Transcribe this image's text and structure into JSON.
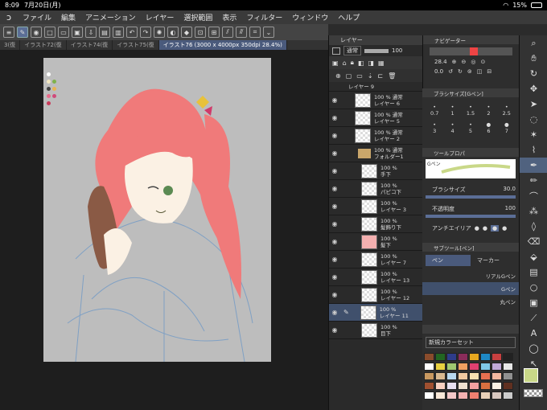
{
  "status": {
    "time": "8:09",
    "date": "7月20日(月)",
    "battery": "15%"
  },
  "menu": [
    "ファイル",
    "編集",
    "アニメーション",
    "レイヤー",
    "選択範囲",
    "表示",
    "フィルター",
    "ウィンドウ",
    "ヘルプ"
  ],
  "tabs": [
    "3(復",
    "イラスト72(復",
    "イラスト74(復",
    "イラスト75(復",
    "イラスト76 (3000 x 4000px 350dpi 28.4%)"
  ],
  "layers": {
    "title": "レイヤー",
    "blend": "通常",
    "opacity": "100",
    "items": [
      {
        "percent": "",
        "name": "レイヤー 9"
      },
      {
        "percent": "100 % 通常",
        "name": "レイヤー 6"
      },
      {
        "percent": "100 % 通常",
        "name": "レイヤー 5"
      },
      {
        "percent": "100 % 通常",
        "name": "レイヤー 2"
      },
      {
        "percent": "100 % 通常",
        "name": "フォルダー1"
      },
      {
        "percent": "100 %",
        "name": "手下"
      },
      {
        "percent": "100 %",
        "name": "パピコ下"
      },
      {
        "percent": "100 %",
        "name": "レイヤー 3"
      },
      {
        "percent": "100 %",
        "name": "髪飾り下"
      },
      {
        "percent": "100 %",
        "name": "髪下"
      },
      {
        "percent": "100 %",
        "name": "レイヤー 7"
      },
      {
        "percent": "100 %",
        "name": "レイヤー 13"
      },
      {
        "percent": "100 %",
        "name": "レイヤー 12"
      },
      {
        "percent": "100 %",
        "name": "レイヤー 11"
      },
      {
        "percent": "100 %",
        "name": "目下"
      }
    ]
  },
  "navigator": {
    "title": "ナビゲーター",
    "zoom": "28.4",
    "angle": "0.0"
  },
  "brush_size": {
    "title": "ブラシサイズ[Gペン]",
    "values": [
      "0.7",
      "1",
      "1.5",
      "2",
      "2.5",
      "3",
      "4",
      "5",
      "6",
      "7"
    ]
  },
  "tool_property": {
    "title": "ツールプロパ",
    "size_label": "ブラシサイズ",
    "size_value": "30.0",
    "opacity_label": "不透明度",
    "opacity_value": "100",
    "aa_label": "アンチエイリア",
    "brush_name": "Gペン"
  },
  "subtool": {
    "title": "サブツール[ペン]",
    "tab1": "ペン",
    "tab2": "マーカー",
    "items": [
      "リアルGペン",
      "Gペン",
      "丸ペン"
    ]
  },
  "colorset": {
    "title": "新規カラーセット"
  },
  "colors": {
    "accent": "#5b6e96",
    "hair": "#f07a7a",
    "fg": "#c9d888"
  }
}
